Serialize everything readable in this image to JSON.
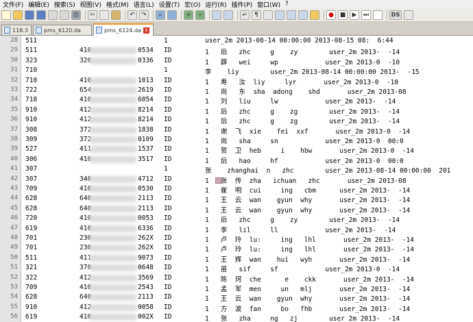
{
  "menu": [
    "文件(F)",
    "编辑(E)",
    "搜索(S)",
    "视图(V)",
    "格式(M)",
    "语言(L)",
    "设置(T)",
    "宏(O)",
    "运行(R)",
    "插件(P)",
    "窗口(W)",
    "?"
  ],
  "toolbar_icons": [
    "new-icon",
    "open-icon",
    "save-icon",
    "save-all-icon",
    "close-icon",
    "close-all-icon",
    "print-icon",
    "cut-icon",
    "copy-icon",
    "paste-icon",
    "undo-icon",
    "redo-icon",
    "find-icon",
    "replace-icon",
    "zoom-in-icon",
    "zoom-out-icon",
    "sync-v-icon",
    "sync-h-icon",
    "wrap-icon",
    "show-all-icon",
    "indent-guide-icon",
    "udl-icon",
    "doc-map-icon",
    "func-list-icon",
    "folder-workspace-icon",
    "record-macro-icon",
    "stop-macro-icon",
    "play-macro-icon",
    "run-macro-multi-icon",
    "save-macro-icon",
    "ds-icon",
    "misc-icon"
  ],
  "tabs": [
    {
      "label": "118.3",
      "active": false
    },
    {
      "label": "pms_6120.da",
      "active": false
    },
    {
      "label": "pms_6124.da",
      "active": true
    }
  ],
  "lines": [
    {
      "n": "28",
      "c1": "511",
      "c2": "",
      "c3": "",
      "c4": "1",
      "rest": "user_2m 2013-08-14 00:00:00 2013-08-15 08:  6:44"
    },
    {
      "n": "29",
      "c1": "511",
      "c2": "410",
      "c3": "0534",
      "c4": "ID",
      "rest": "1   后   zhc     g    zy        user_2m 2013-  -14"
    },
    {
      "n": "30",
      "c1": "323",
      "c2": "320",
      "c3": "0336",
      "c4": "ID",
      "rest": "1   薛   wei     wp            user_2m 2013-0  -10"
    },
    {
      "n": "31",
      "c1": "710",
      "c2": "",
      "c3": "",
      "c4": "1",
      "rest": "李    liy        user_2m 2013-08-14 00:00:00 2013-  -15"
    },
    {
      "n": "32",
      "c1": "710",
      "c2": "410",
      "c3": "1013",
      "c4": "ID",
      "rest": "1   寿   汝  liy     lyr       user_2m 2013-0  -10"
    },
    {
      "n": "33",
      "c1": "722",
      "c2": "654",
      "c3": "2619",
      "c4": "ID",
      "rest": "1   尚   东  sha  adong    shd       user_2m 2013-08"
    },
    {
      "n": "34",
      "c1": "718",
      "c2": "410",
      "c3": "6054",
      "c4": "ID",
      "rest": "1   刘   liu     lw            user_2m 2013-  -14"
    },
    {
      "n": "35",
      "c1": "910",
      "c2": "412",
      "c3": "8214",
      "c4": "ID",
      "rest": "1   后   zhc     g    zg        user_2m 2013-  -14"
    },
    {
      "n": "36",
      "c1": "910",
      "c2": "412",
      "c3": "8214",
      "c4": "ID",
      "rest": "1   后   zhc     g    zg        user_2m 2013-  -14"
    },
    {
      "n": "37",
      "c1": "308",
      "c2": "372",
      "c3": "1838",
      "c4": "ID",
      "rest": "1   谢  飞  xie    fei  xxf       user_2m 2013-0  -14"
    },
    {
      "n": "38",
      "c1": "309",
      "c2": "372",
      "c3": "0109",
      "c4": "ID",
      "rest": "1   尚   sha     sn            user_2m 2013-0  00:0"
    },
    {
      "n": "39",
      "c1": "527",
      "c2": "411",
      "c3": "1537",
      "c4": "ID",
      "rest": "1   贺  卫  heb     i    hbw       user_2m 2013-0  -14"
    },
    {
      "n": "40",
      "c1": "306",
      "c2": "410",
      "c3": "3517",
      "c4": "ID",
      "rest": "1   后   hao     hf            user_2m 2013-0  00:0"
    },
    {
      "n": "41",
      "c1": "307",
      "c2": "",
      "c3": "",
      "c4": "1",
      "rest": "张    zhanghai  n   zhc        user_2m 2013-08-14 00:00:00  201"
    },
    {
      "n": "42",
      "c1": "307",
      "c2": "340",
      "c3": "4712",
      "c4": "ID",
      "rest": "1   张  传  zha   ichuan   zhc       user_2m 2013-08"
    },
    {
      "n": "43",
      "c1": "709",
      "c2": "410",
      "c3": "0530",
      "c4": "ID",
      "rest": "1   崔  明  cui     ing   cbm      user_2m 2013-  -14"
    },
    {
      "n": "44",
      "c1": "628",
      "c2": "640",
      "c3": "2113",
      "c4": "ID",
      "rest": "1   王  云  wan    gyun  why       user_2m 2013-  -14"
    },
    {
      "n": "45",
      "c1": "628",
      "c2": "640",
      "c3": "2113",
      "c4": "ID",
      "rest": "1   王  云  wan    gyun  why       user_2m 2013-  -14"
    },
    {
      "n": "46",
      "c1": "720",
      "c2": "410",
      "c3": "0053",
      "c4": "ID",
      "rest": "1   后   zhc     g    zy        user_2m 2013-  -14"
    },
    {
      "n": "47",
      "c1": "619",
      "c2": "410",
      "c3": "6336",
      "c4": "ID",
      "rest": "1   李   lil     ll            user_2m 2013-  -14"
    },
    {
      "n": "48",
      "c1": "701",
      "c2": "230",
      "c3": "262X",
      "c4": "ID",
      "rest": "1   卢  玲  lu:     ing   lhl       user_2m 2013-  -14"
    },
    {
      "n": "49",
      "c1": "701",
      "c2": "230",
      "c3": "262X",
      "c4": "ID",
      "rest": "1   卢  玲  lu:     ing   lhl       user_2m 2013-  -14"
    },
    {
      "n": "50",
      "c1": "511",
      "c2": "411",
      "c3": "9073",
      "c4": "ID",
      "rest": "1   王  辉  wan    hui   wyh       user_2m 2013-  -14"
    },
    {
      "n": "51",
      "c1": "321",
      "c2": "370",
      "c3": "0648",
      "c4": "ID",
      "rest": "1   苗   sif     sf            user_2m 2013-0  -14"
    },
    {
      "n": "52",
      "c1": "322",
      "c2": "412",
      "c3": "3569",
      "c4": "ID",
      "rest": "1   陈  珂  che      e    ckk       user_2m 2013-  -14"
    },
    {
      "n": "53",
      "c1": "709",
      "c2": "410",
      "c3": "2543",
      "c4": "ID",
      "rest": "1   孟  军  men     un   mlj       user_2m 2013-  -14"
    },
    {
      "n": "54",
      "c1": "628",
      "c2": "640",
      "c3": "2113",
      "c4": "ID",
      "rest": "1   王  云  wan    gyun  why       user_2m 2013-  -14"
    },
    {
      "n": "55",
      "c1": "910",
      "c2": "412",
      "c3": "0058",
      "c4": "ID",
      "rest": "1   方  波  fan     bo   fhb       user_2m 2013-  -14"
    },
    {
      "n": "56",
      "c1": "619",
      "c2": "410",
      "c3": "002X",
      "c4": "ID",
      "rest": "1   张   zha     ng   zj        user_2m 2013-  -14"
    },
    {
      "n": "57",
      "c1": "718",
      "c2": "410",
      "c3": "0081",
      "c4": "ID",
      "rest": "1   张   zha     ng   zh        user_2m 2013-  -14"
    }
  ]
}
